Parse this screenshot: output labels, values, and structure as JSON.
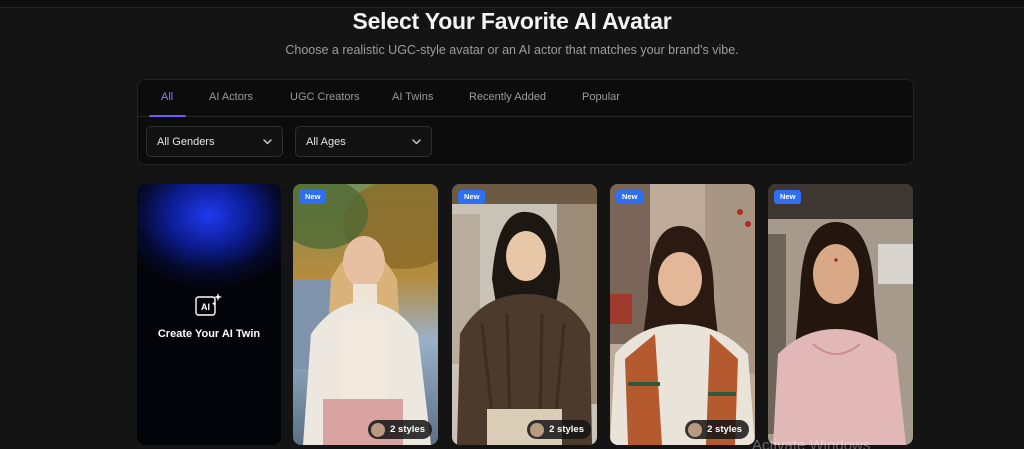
{
  "header": {
    "title": "Select Your Favorite AI Avatar",
    "subtitle": "Choose a realistic UGC-style avatar or an AI actor that matches your brand's vibe."
  },
  "tabs": [
    {
      "label": "All",
      "active": true
    },
    {
      "label": "AI Actors",
      "active": false
    },
    {
      "label": "UGC Creators",
      "active": false
    },
    {
      "label": "AI Twins",
      "active": false
    },
    {
      "label": "Recently Added",
      "active": false
    },
    {
      "label": "Popular",
      "active": false
    }
  ],
  "filters": {
    "gender": {
      "selected": "All Genders",
      "icon": "chevron-down-icon"
    },
    "age": {
      "selected": "All Ages",
      "icon": "chevron-down-icon"
    }
  },
  "create_card": {
    "label": "Create Your AI Twin",
    "icon_text": "AI",
    "icon": "ai-sparkle-icon"
  },
  "avatars": [
    {
      "badge": "New",
      "styles": "2 styles"
    },
    {
      "badge": "New",
      "styles": "2 styles"
    },
    {
      "badge": "New",
      "styles": "2 styles"
    },
    {
      "badge": "New",
      "styles": ""
    }
  ],
  "watermark": "Activate Windows",
  "colors": {
    "background": "#141414",
    "accent": "#6f5cff",
    "badge": "#2f6ff2"
  }
}
